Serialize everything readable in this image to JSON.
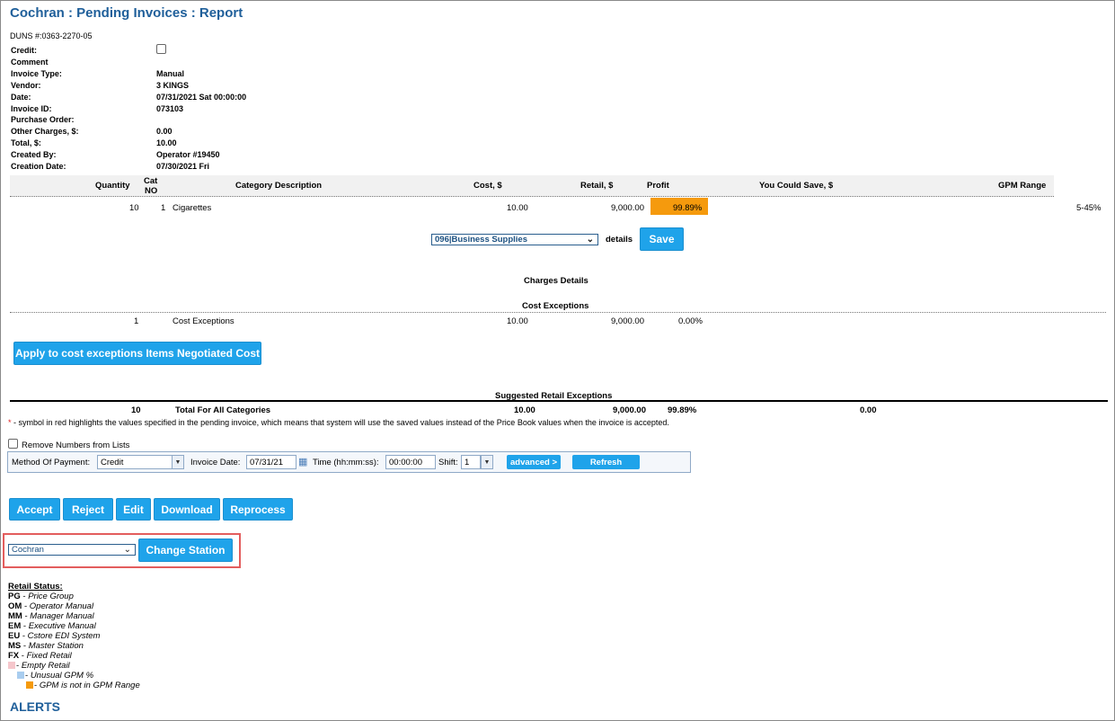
{
  "page": {
    "title": "Cochran : Pending Invoices : Report",
    "duns": "DUNS #:0363-2270-05"
  },
  "invoice_info": {
    "credit_label": "Credit:",
    "comment_label": "Comment",
    "invoice_type_label": "Invoice Type:",
    "invoice_type": "Manual",
    "vendor_label": "Vendor:",
    "vendor": "3 KINGS",
    "date_label": "Date:",
    "date": "07/31/2021 Sat 00:00:00",
    "invoice_id_label": "Invoice ID:",
    "invoice_id": "073103",
    "po_label": "Purchase Order:",
    "other_charges_label": "Other Charges, $:",
    "other_charges": "0.00",
    "total_label": "Total, $:",
    "total": "10.00",
    "created_by_label": "Created By:",
    "created_by": "Operator #19450",
    "creation_date_label": "Creation Date:",
    "creation_date": "07/30/2021 Fri"
  },
  "table": {
    "headers": {
      "quantity": "Quantity",
      "cat1": "Cat",
      "cat2": "NO",
      "category": "Category Description",
      "cost": "Cost, $",
      "retail": "Retail, $",
      "profit": "Profit",
      "save": "You Could Save, $",
      "gpm": "GPM Range"
    },
    "row": {
      "quantity": "10",
      "cat": "1",
      "category": "Cigarettes",
      "cost": "10.00",
      "retail": "9,000.00",
      "profit": "99.89%",
      "gpm": "5-45%"
    }
  },
  "category_select": {
    "value": "096|Business Supplies",
    "details_label": "details",
    "save_label": "Save"
  },
  "sections": {
    "charges": "Charges Details",
    "cost_exceptions": "Cost Exceptions",
    "suggested": "Suggested Retail Exceptions"
  },
  "cost_exception_row": {
    "qty": "1",
    "name": "Cost Exceptions",
    "cost": "10.00",
    "retail": "9,000.00",
    "profit": "0.00%"
  },
  "apply_button": "Apply to cost exceptions Items Negotiated Cost",
  "totals": {
    "qty": "10",
    "label": "Total For All Categories",
    "cost": "10.00",
    "retail": "9,000.00",
    "profit": "99.89%",
    "save": "0.00"
  },
  "note": {
    "star": "*",
    "text": " - symbol in red highlights the values specified in the pending invoice, which means that system will use the saved values instead of the Price Book values when the invoice is accepted."
  },
  "remove_numbers_label": "Remove Numbers from Lists",
  "payment": {
    "method_label": "Method Of Payment:",
    "method": "Credit",
    "invoice_date_label": "Invoice Date:",
    "invoice_date": "07/31/21",
    "time_label": "Time (hh:mm:ss):",
    "time": "00:00:00",
    "shift_label": "Shift:",
    "shift": "1",
    "advanced_label": "advanced >",
    "refresh_label": "Refresh"
  },
  "actions": {
    "accept": "Accept",
    "reject": "Reject",
    "edit": "Edit",
    "download": "Download",
    "reprocess": "Reprocess"
  },
  "station": {
    "value": "Cochran",
    "button": "Change Station"
  },
  "retail_status": {
    "title": "Retail Status:",
    "items": [
      {
        "code": "PG",
        "desc": "Price Group"
      },
      {
        "code": "OM",
        "desc": "Operator Manual"
      },
      {
        "code": "MM",
        "desc": "Manager Manual"
      },
      {
        "code": "EM",
        "desc": "Executive Manual"
      },
      {
        "code": "EU",
        "desc": "Cstore EDI System"
      },
      {
        "code": "MS",
        "desc": "Master Station"
      },
      {
        "code": "FX",
        "desc": "Fixed Retail"
      }
    ],
    "colors": [
      {
        "desc": "Empty Retail",
        "color": "#f5c6cb"
      },
      {
        "desc": "Unusual GPM %",
        "color": "#a9cdef"
      },
      {
        "desc": "GPM is not in GPM Range",
        "color": "#f59a0d"
      }
    ]
  },
  "alerts_title": "ALERTS"
}
